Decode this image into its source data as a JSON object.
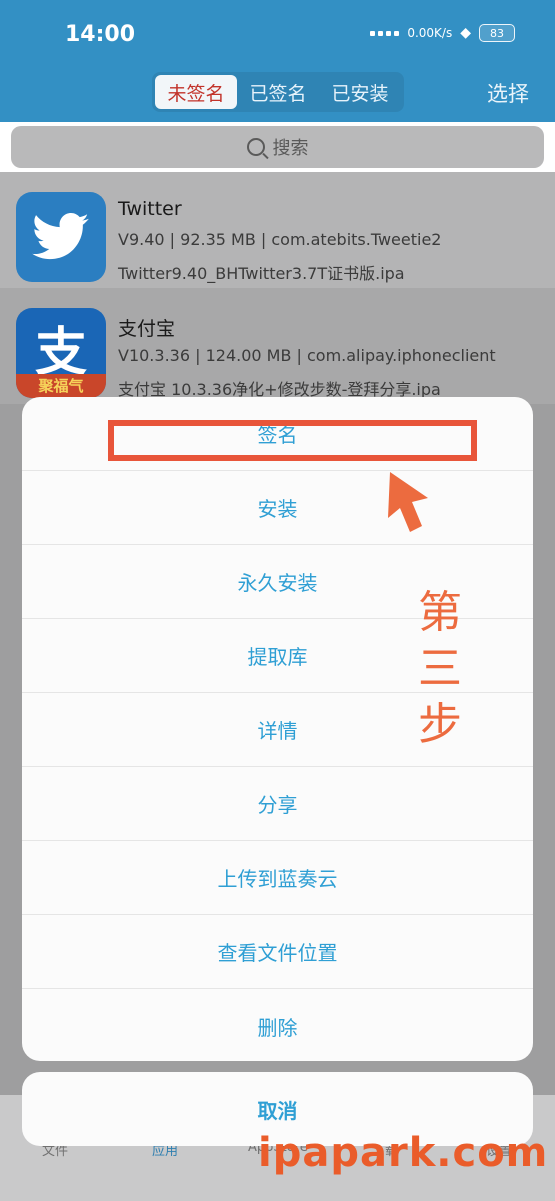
{
  "status_bar": {
    "time": "14:00",
    "net_speed": "0.00K/s",
    "battery": "83"
  },
  "header": {
    "tabs": [
      {
        "label": "未签名",
        "active": true
      },
      {
        "label": "已签名",
        "active": false
      },
      {
        "label": "已安装",
        "active": false
      }
    ],
    "select_label": "选择"
  },
  "search": {
    "placeholder": "搜索"
  },
  "apps": [
    {
      "name": "Twitter",
      "meta": "V9.40 | 92.35 MB | com.atebits.Tweetie2",
      "file": "Twitter9.40_BHTwitter3.7T证书版.ipa",
      "icon": "twitter-bird-icon"
    },
    {
      "name": "支付宝",
      "meta": "V10.3.36 | 124.00 MB | com.alipay.iphoneclient",
      "file": "支付宝 10.3.36净化+修改步数-登拜分享.ipa",
      "icon": "alipay-icon",
      "icon_char": "支",
      "icon_band": "聚福气"
    }
  ],
  "action_sheet": {
    "items": [
      "签名",
      "安装",
      "永久安装",
      "提取库",
      "详情",
      "分享",
      "上传到蓝奏云",
      "查看文件位置",
      "删除"
    ],
    "cancel": "取消"
  },
  "tabbar": {
    "items": [
      "文件",
      "应用",
      "AppStore",
      "下载",
      "设置"
    ]
  },
  "annotation": {
    "step_chars": [
      "第",
      "三",
      "步"
    ]
  },
  "watermark": "ipapark.com",
  "colors": {
    "header": "#3390c4",
    "action_text": "#2f9fd4",
    "annotation": "#e8553a"
  }
}
